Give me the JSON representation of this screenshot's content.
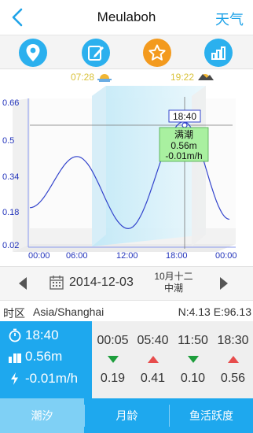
{
  "header": {
    "title": "Meulaboh",
    "weather_label": "天气"
  },
  "icons": {
    "location": "location-pin-icon",
    "edit": "edit-note-icon",
    "favorite": "star-icon",
    "stats": "bar-chart-icon"
  },
  "chart_header": {
    "sunrise": "07:28",
    "sunset": "19:22"
  },
  "chart_data": {
    "type": "line",
    "x_ticks": [
      "00:00",
      "06:00",
      "12:00",
      "18:00",
      "00:00"
    ],
    "y_ticks": [
      "0.66",
      "0.5",
      "0.34",
      "0.18",
      "0.02"
    ],
    "ylim": [
      0.02,
      0.66
    ],
    "series": [
      {
        "x": [
          "00:00",
          "05:40",
          "11:50",
          "18:30",
          "24:00"
        ],
        "values": [
          0.19,
          0.41,
          0.1,
          0.56,
          0.14
        ]
      }
    ],
    "high_tide_marker": {
      "time": "18:40",
      "label": "满潮",
      "height": "0.56m",
      "rate": "-0.01m/h"
    }
  },
  "date_bar": {
    "date": "2014-12-03",
    "lunar_date": "10月十二",
    "tide_type": "中潮"
  },
  "timezone": {
    "label": "时区",
    "value": "Asia/Shanghai",
    "coords": "N:4.13  E:96.13"
  },
  "current": {
    "time": "18:40",
    "height": "0.56m",
    "rate": "-0.01m/h"
  },
  "tides": [
    {
      "time": "00:05",
      "trend": "down",
      "height": "0.19"
    },
    {
      "time": "05:40",
      "trend": "up",
      "height": "0.41"
    },
    {
      "time": "11:50",
      "trend": "down",
      "height": "0.10"
    },
    {
      "time": "18:30",
      "trend": "up",
      "height": "0.56"
    }
  ],
  "colors": {
    "accent": "#1ea8ee",
    "up": "#e74c4c",
    "down": "#1d9e3c",
    "curve": "#3344cc"
  },
  "tabs": [
    {
      "label": "潮汐"
    },
    {
      "label": "月龄"
    },
    {
      "label": "鱼活跃度"
    }
  ]
}
